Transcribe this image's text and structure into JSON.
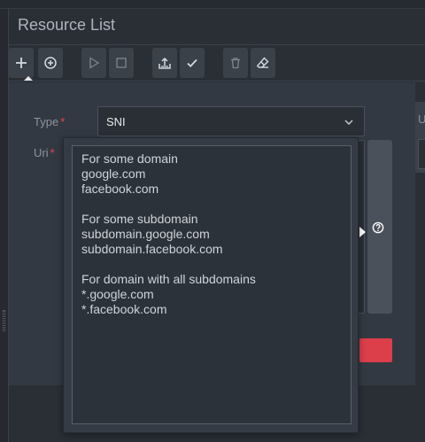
{
  "header": {
    "title": "Resource List"
  },
  "toolbar": {
    "buttons": [
      {
        "icon": "plus-icon",
        "enabled": true
      },
      {
        "icon": "add-circle-icon",
        "enabled": true
      },
      {
        "icon": "play-icon",
        "enabled": false
      },
      {
        "icon": "stop-icon",
        "enabled": false
      },
      {
        "icon": "export-icon",
        "enabled": true
      },
      {
        "icon": "check-icon",
        "enabled": true
      },
      {
        "icon": "trash-icon",
        "enabled": false
      },
      {
        "icon": "eraser-icon",
        "enabled": true
      }
    ]
  },
  "form": {
    "type_label": "Type",
    "type_required": "*",
    "type_value": "SNI",
    "uri_label": "Uri",
    "uri_required": "*",
    "uri_value": ""
  },
  "right_panel": {
    "label": "U"
  },
  "tooltip": {
    "lines": [
      "For some domain",
      "google.com",
      "facebook.com",
      "",
      "For some subdomain",
      "subdomain.google.com",
      "subdomain.facebook.com",
      "",
      "For domain with all subdomains",
      "*.google.com",
      "*.facebook.com"
    ]
  },
  "colors": {
    "background": "#2a2f36",
    "panel": "#333942",
    "required": "#e0454f",
    "danger_button": "#dc3e4a"
  }
}
